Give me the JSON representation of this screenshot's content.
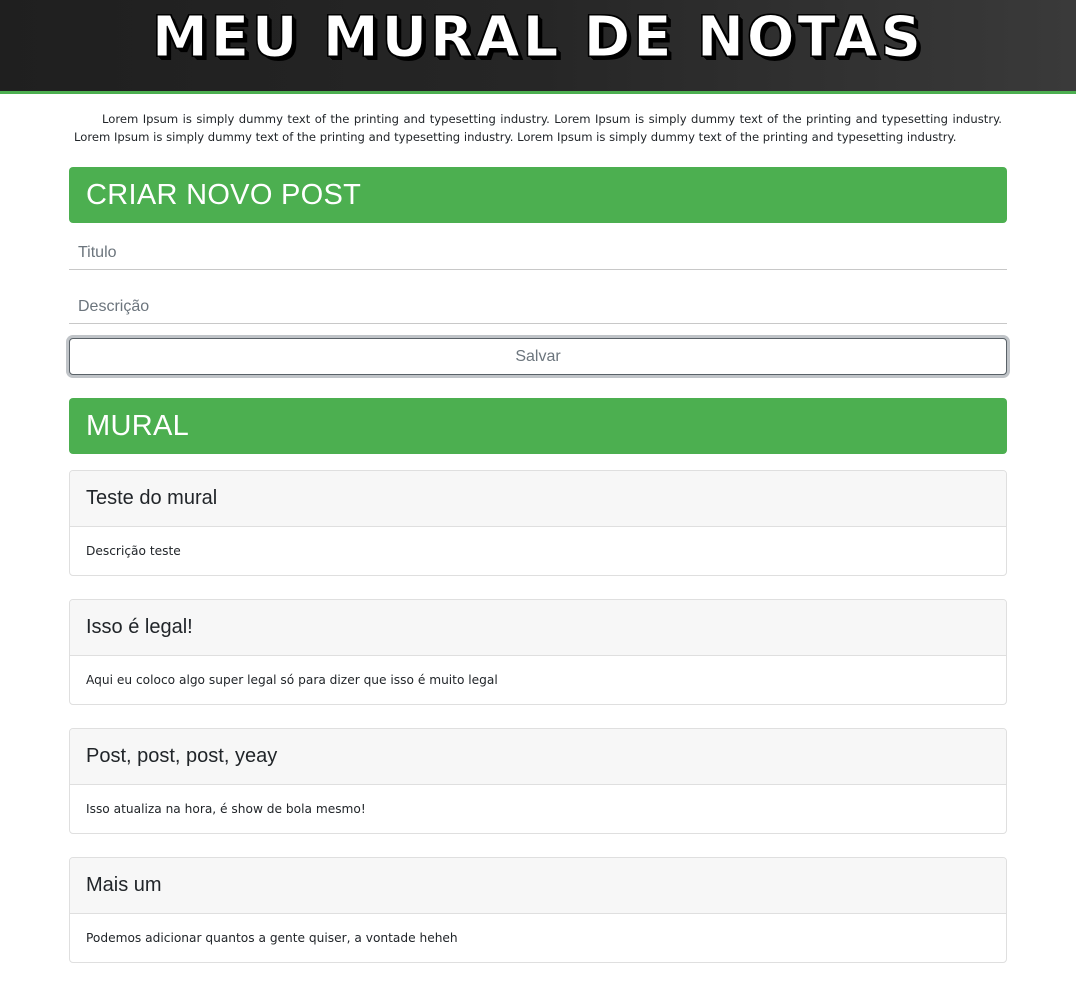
{
  "header": {
    "title": "MEU MURAL DE NOTAS"
  },
  "intro": {
    "text": "Lorem Ipsum is simply dummy text of the printing and typesetting industry. Lorem Ipsum is simply dummy text of the printing and typesetting industry. Lorem Ipsum is simply dummy text of the printing and typesetting industry. Lorem Ipsum is simply dummy text of the printing and typesetting industry."
  },
  "create": {
    "heading": "CRIAR NOVO POST",
    "title_placeholder": "Titulo",
    "title_value": "",
    "description_placeholder": "Descrição",
    "description_value": "",
    "save_label": "Salvar"
  },
  "mural": {
    "heading": "MURAL",
    "posts": [
      {
        "title": "Teste do mural",
        "description": "Descrição teste"
      },
      {
        "title": "Isso é legal!",
        "description": "Aqui eu coloco algo super legal só para dizer que isso é muito legal"
      },
      {
        "title": "Post, post, post, yeay",
        "description": "Isso atualiza na hora, é show de bola mesmo!"
      },
      {
        "title": "Mais um",
        "description": "Podemos adicionar quantos a gente quiser, a vontade heheh"
      }
    ]
  },
  "colors": {
    "accent": "#4caf50",
    "header_bg": "#262626"
  }
}
